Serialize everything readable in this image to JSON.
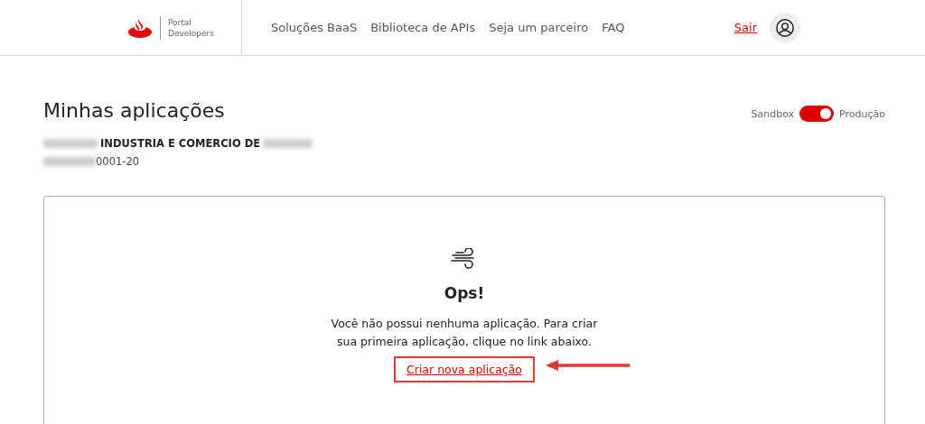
{
  "header": {
    "logo_text": [
      "Portal",
      "Developers"
    ],
    "nav": [
      {
        "label": "Soluções BaaS"
      },
      {
        "label": "Biblioteca de APIs"
      },
      {
        "label": "Seja um parceiro"
      },
      {
        "label": "FAQ"
      }
    ],
    "logout": "Sair"
  },
  "page": {
    "title": "Minhas aplicações",
    "company": "INDUSTRIA E COMERCIO DE",
    "document": "0001-20",
    "environment": {
      "left_label": "Sandbox",
      "right_label": "Produção",
      "on": true
    }
  },
  "empty_state": {
    "title": "Ops!",
    "message": "Você não possui nenhuma aplicação. Para criar sua primeira aplicação, clique no link abaixo.",
    "link": "Criar nova aplicação",
    "highlighted": true
  }
}
